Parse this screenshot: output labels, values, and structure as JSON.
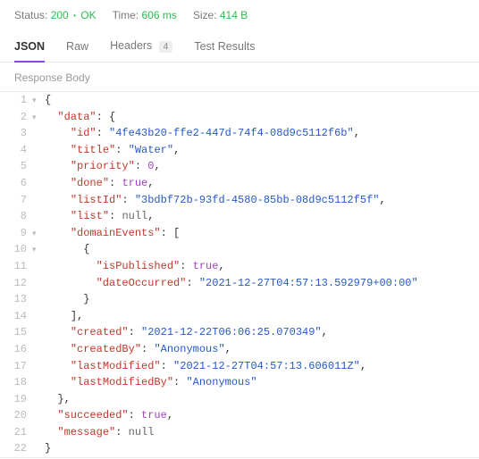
{
  "status_bar": {
    "status_label": "Status:",
    "code": "200",
    "bullet": "•",
    "ok": "OK",
    "time_label": "Time:",
    "time_value": "606 ms",
    "size_label": "Size:",
    "size_value": "414 B"
  },
  "tabs": {
    "json": "JSON",
    "raw": "Raw",
    "headers": "Headers",
    "headers_count": "4",
    "tests": "Test Results"
  },
  "section": "Response Body",
  "code_rows": [
    {
      "n": "1",
      "fold": "▾",
      "indent": 0,
      "tokens": [
        [
          "punct",
          "{"
        ]
      ]
    },
    {
      "n": "2",
      "fold": "▾",
      "indent": 1,
      "tokens": [
        [
          "key",
          "\"data\""
        ],
        [
          "punct",
          ": {"
        ]
      ]
    },
    {
      "n": "3",
      "fold": "",
      "indent": 2,
      "tokens": [
        [
          "key",
          "\"id\""
        ],
        [
          "punct",
          ": "
        ],
        [
          "str",
          "\"4fe43b20-ffe2-447d-74f4-08d9c5112f6b\""
        ],
        [
          "punct",
          ","
        ]
      ]
    },
    {
      "n": "4",
      "fold": "",
      "indent": 2,
      "tokens": [
        [
          "key",
          "\"title\""
        ],
        [
          "punct",
          ": "
        ],
        [
          "str",
          "\"Water\""
        ],
        [
          "punct",
          ","
        ]
      ]
    },
    {
      "n": "5",
      "fold": "",
      "indent": 2,
      "tokens": [
        [
          "key",
          "\"priority\""
        ],
        [
          "punct",
          ": "
        ],
        [
          "num",
          "0"
        ],
        [
          "punct",
          ","
        ]
      ]
    },
    {
      "n": "6",
      "fold": "",
      "indent": 2,
      "tokens": [
        [
          "key",
          "\"done\""
        ],
        [
          "punct",
          ": "
        ],
        [
          "bool",
          "true"
        ],
        [
          "punct",
          ","
        ]
      ]
    },
    {
      "n": "7",
      "fold": "",
      "indent": 2,
      "tokens": [
        [
          "key",
          "\"listId\""
        ],
        [
          "punct",
          ": "
        ],
        [
          "str",
          "\"3bdbf72b-93fd-4580-85bb-08d9c5112f5f\""
        ],
        [
          "punct",
          ","
        ]
      ]
    },
    {
      "n": "8",
      "fold": "",
      "indent": 2,
      "tokens": [
        [
          "key",
          "\"list\""
        ],
        [
          "punct",
          ": "
        ],
        [
          "null",
          "null"
        ],
        [
          "punct",
          ","
        ]
      ]
    },
    {
      "n": "9",
      "fold": "▾",
      "indent": 2,
      "tokens": [
        [
          "key",
          "\"domainEvents\""
        ],
        [
          "punct",
          ": ["
        ]
      ]
    },
    {
      "n": "10",
      "fold": "▾",
      "indent": 3,
      "tokens": [
        [
          "punct",
          "{"
        ]
      ]
    },
    {
      "n": "11",
      "fold": "",
      "indent": 4,
      "tokens": [
        [
          "key",
          "\"isPublished\""
        ],
        [
          "punct",
          ": "
        ],
        [
          "bool",
          "true"
        ],
        [
          "punct",
          ","
        ]
      ]
    },
    {
      "n": "12",
      "fold": "",
      "indent": 4,
      "tokens": [
        [
          "key",
          "\"dateOccurred\""
        ],
        [
          "punct",
          ": "
        ],
        [
          "str",
          "\"2021-12-27T04:57:13.592979+00:00\""
        ]
      ]
    },
    {
      "n": "13",
      "fold": "",
      "indent": 3,
      "tokens": [
        [
          "punct",
          "}"
        ]
      ]
    },
    {
      "n": "14",
      "fold": "",
      "indent": 2,
      "tokens": [
        [
          "punct",
          "],"
        ]
      ]
    },
    {
      "n": "15",
      "fold": "",
      "indent": 2,
      "tokens": [
        [
          "key",
          "\"created\""
        ],
        [
          "punct",
          ": "
        ],
        [
          "str",
          "\"2021-12-22T06:06:25.070349\""
        ],
        [
          "punct",
          ","
        ]
      ]
    },
    {
      "n": "16",
      "fold": "",
      "indent": 2,
      "tokens": [
        [
          "key",
          "\"createdBy\""
        ],
        [
          "punct",
          ": "
        ],
        [
          "str",
          "\"Anonymous\""
        ],
        [
          "punct",
          ","
        ]
      ]
    },
    {
      "n": "17",
      "fold": "",
      "indent": 2,
      "tokens": [
        [
          "key",
          "\"lastModified\""
        ],
        [
          "punct",
          ": "
        ],
        [
          "str",
          "\"2021-12-27T04:57:13.606011Z\""
        ],
        [
          "punct",
          ","
        ]
      ]
    },
    {
      "n": "18",
      "fold": "",
      "indent": 2,
      "tokens": [
        [
          "key",
          "\"lastModifiedBy\""
        ],
        [
          "punct",
          ": "
        ],
        [
          "str",
          "\"Anonymous\""
        ]
      ]
    },
    {
      "n": "19",
      "fold": "",
      "indent": 1,
      "tokens": [
        [
          "punct",
          "},"
        ]
      ]
    },
    {
      "n": "20",
      "fold": "",
      "indent": 1,
      "tokens": [
        [
          "key",
          "\"succeeded\""
        ],
        [
          "punct",
          ": "
        ],
        [
          "bool",
          "true"
        ],
        [
          "punct",
          ","
        ]
      ]
    },
    {
      "n": "21",
      "fold": "",
      "indent": 1,
      "tokens": [
        [
          "key",
          "\"message\""
        ],
        [
          "punct",
          ": "
        ],
        [
          "null",
          "null"
        ]
      ]
    },
    {
      "n": "22",
      "fold": "",
      "indent": 0,
      "tokens": [
        [
          "punct",
          "}"
        ]
      ]
    }
  ]
}
